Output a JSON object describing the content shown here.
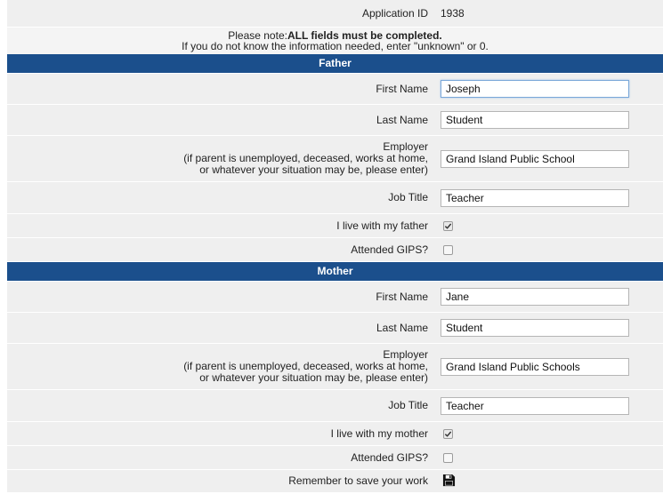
{
  "app_id": {
    "label": "Application ID",
    "value": "1938"
  },
  "note": {
    "prefix": "Please note:",
    "bold": "ALL fields must be completed.",
    "line2": "If you do not know the information needed, enter \"unknown\" or 0."
  },
  "father": {
    "heading": "Father",
    "first_name_label": "First Name",
    "first_name": "Joseph",
    "last_name_label": "Last Name",
    "last_name": "Student",
    "employer_label_1": "Employer",
    "employer_label_2": "(if parent is unemployed, deceased, works at home,",
    "employer_label_3": "or whatever your situation may be, please enter)",
    "employer": "Grand Island Public School",
    "job_title_label": "Job Title",
    "job_title": "Teacher",
    "live_with_label": "I live with my father",
    "live_with": true,
    "attended_label": "Attended GIPS?",
    "attended": false
  },
  "mother": {
    "heading": "Mother",
    "first_name_label": "First Name",
    "first_name": "Jane",
    "last_name_label": "Last Name",
    "last_name": "Student",
    "employer_label_1": "Employer",
    "employer_label_2": "(if parent is unemployed, deceased, works at home,",
    "employer_label_3": "or whatever your situation may be, please enter)",
    "employer": "Grand Island Public Schools",
    "job_title_label": "Job Title",
    "job_title": "Teacher",
    "live_with_label": "I live with my mother",
    "live_with": true,
    "attended_label": "Attended GIPS?",
    "attended": false
  },
  "save": {
    "label": "Remember to save your work",
    "icon": "floppy-disk-icon"
  },
  "colors": {
    "section_header": "#1b4f8c",
    "row_bg": "#efefef"
  }
}
